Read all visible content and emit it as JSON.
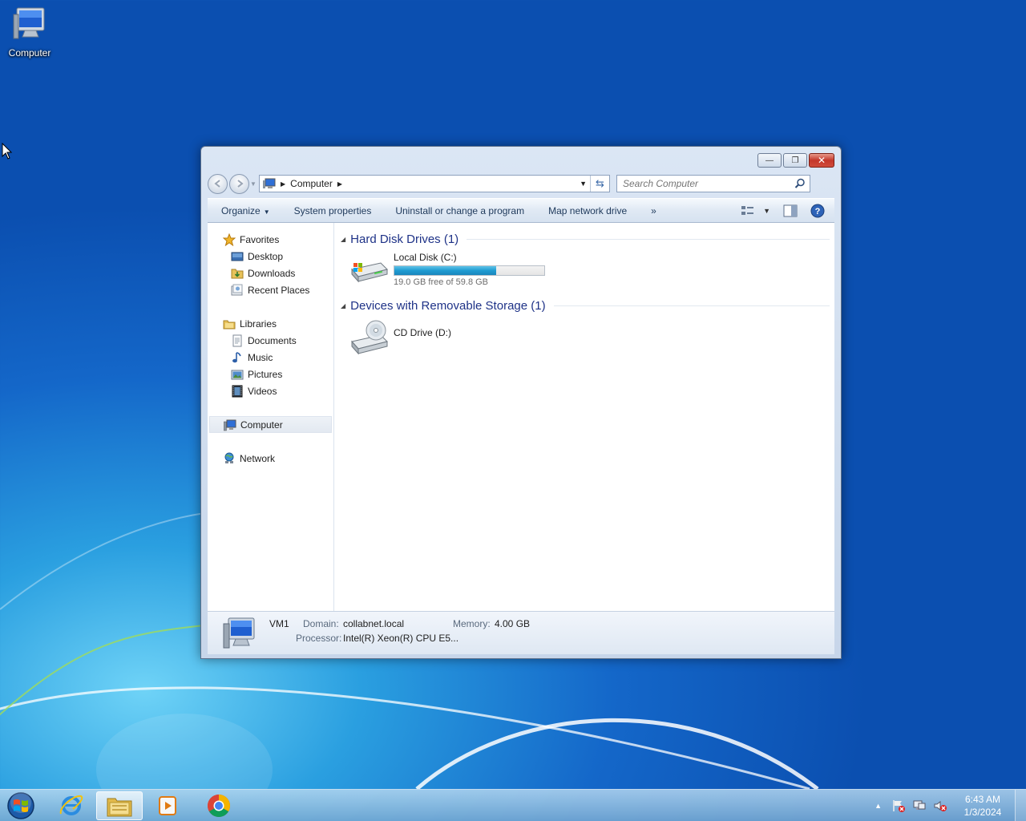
{
  "desktop": {
    "computer_icon_label": "Computer"
  },
  "window": {
    "caption_buttons": {
      "minimize": "—",
      "maximize": "❐",
      "close": "✕"
    },
    "address": {
      "crumbs": [
        "Computer"
      ]
    },
    "search": {
      "placeholder": "Search Computer"
    },
    "toolbar": {
      "organize": "Organize",
      "system_properties": "System properties",
      "uninstall": "Uninstall or change a program",
      "map_drive": "Map network drive",
      "more": "»"
    },
    "nav": {
      "favorites": "Favorites",
      "desktop": "Desktop",
      "downloads": "Downloads",
      "recent_places": "Recent Places",
      "libraries": "Libraries",
      "documents": "Documents",
      "music": "Music",
      "pictures": "Pictures",
      "videos": "Videos",
      "computer": "Computer",
      "network": "Network"
    },
    "groups": {
      "hdd": {
        "title": "Hard Disk Drives (1)",
        "drives": [
          {
            "name": "Local Disk (C:)",
            "free_text": "19.0 GB free of 59.8 GB",
            "used_fraction": 0.68
          }
        ]
      },
      "removable": {
        "title": "Devices with Removable Storage (1)",
        "drives": [
          {
            "name": "CD Drive (D:)"
          }
        ]
      }
    },
    "details": {
      "name": "VM1",
      "domain_label": "Domain:",
      "domain_value": "collabnet.local",
      "memory_label": "Memory:",
      "memory_value": "4.00 GB",
      "processor_label": "Processor:",
      "processor_value": "Intel(R) Xeon(R) CPU E5..."
    }
  },
  "taskbar": {
    "clock_time": "6:43 AM",
    "clock_date": "1/3/2024",
    "tray_arrow": "▲"
  }
}
